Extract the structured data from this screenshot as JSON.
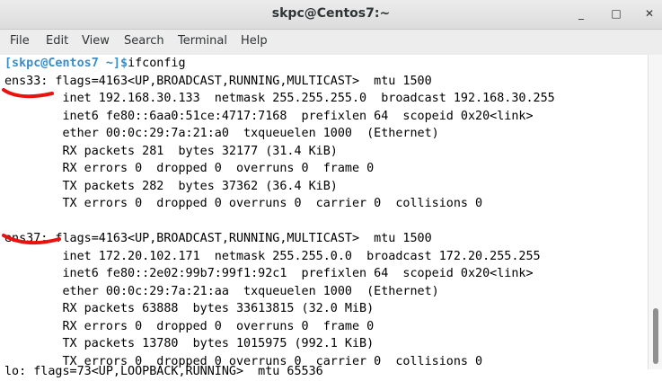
{
  "window": {
    "title": "skpc@Centos7:~",
    "controls": [
      "_",
      "□",
      "✕"
    ]
  },
  "menu": [
    "File",
    "Edit",
    "View",
    "Search",
    "Terminal",
    "Help"
  ],
  "terminal": {
    "prompt": "[skpc@Centos7 ~]$",
    "command": "ifconfig",
    "lines": [
      "ens33: flags=4163<UP,BROADCAST,RUNNING,MULTICAST>  mtu 1500",
      "        inet 192.168.30.133  netmask 255.255.255.0  broadcast 192.168.30.255",
      "        inet6 fe80::6aa0:51ce:4717:7168  prefixlen 64  scopeid 0x20<link>",
      "        ether 00:0c:29:7a:21:a0  txqueuelen 1000  (Ethernet)",
      "        RX packets 281  bytes 32177 (31.4 KiB)",
      "        RX errors 0  dropped 0  overruns 0  frame 0",
      "        TX packets 282  bytes 37362 (36.4 KiB)",
      "        TX errors 0  dropped 0 overruns 0  carrier 0  collisions 0",
      "",
      "ens37: flags=4163<UP,BROADCAST,RUNNING,MULTICAST>  mtu 1500",
      "        inet 172.20.102.171  netmask 255.255.0.0  broadcast 172.20.255.255",
      "        inet6 fe80::2e02:99b7:99f1:92c1  prefixlen 64  scopeid 0x20<link>",
      "        ether 00:0c:29:7a:21:aa  txqueuelen 1000  (Ethernet)",
      "        RX packets 63888  bytes 33613815 (32.0 MiB)",
      "        RX errors 0  dropped 0  overruns 0  frame 0",
      "        TX packets 13780  bytes 1015975 (992.1 KiB)",
      "        TX errors 0  dropped 0 overruns 0  carrier 0  collisions 0",
      "",
      "lo: flags=73<UP,LOOPBACK,RUNNING>  mtu 65536"
    ]
  },
  "colors": {
    "prompt": "#3c8dc4",
    "annotation": "#e8130f"
  }
}
